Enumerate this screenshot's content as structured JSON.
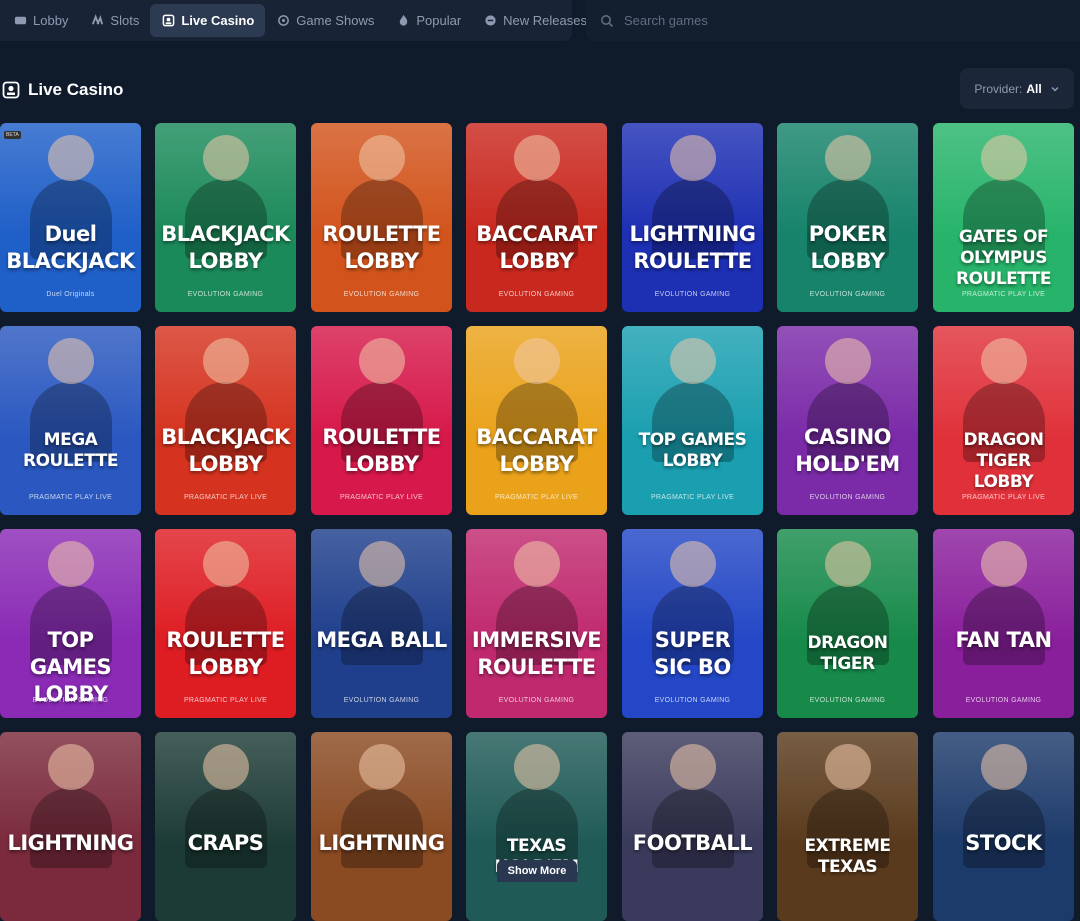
{
  "nav": {
    "tabs": [
      {
        "label": "Lobby",
        "icon": "lobby-icon"
      },
      {
        "label": "Slots",
        "icon": "slots-icon"
      },
      {
        "label": "Live Casino",
        "icon": "live-icon",
        "active": true
      },
      {
        "label": "Game Shows",
        "icon": "game-shows-icon"
      },
      {
        "label": "Popular",
        "icon": "fire-icon"
      },
      {
        "label": "New Releases",
        "icon": "new-releases-icon"
      }
    ],
    "search_placeholder": "Search games"
  },
  "section": {
    "title": "Live Casino"
  },
  "provider_filter": {
    "label": "Provider:",
    "value": "All"
  },
  "games": [
    {
      "title": "Duel\nBLACKJACK",
      "provider": "Duel Originals",
      "badge": "BETA",
      "color": "#1f5fc8"
    },
    {
      "title": "BLACKJACK\nLOBBY",
      "provider": "EVOLUTION GAMING",
      "color": "#1b8a5a"
    },
    {
      "title": "ROULETTE\nLOBBY",
      "provider": "EVOLUTION GAMING",
      "color": "#d2541c"
    },
    {
      "title": "BACCARAT\nLOBBY",
      "provider": "EVOLUTION GAMING",
      "color": "#c9281e"
    },
    {
      "title": "LIGHTNING\nROULETTE",
      "provider": "EVOLUTION GAMING",
      "color": "#1d2fb3"
    },
    {
      "title": "POKER\nLOBBY",
      "provider": "EVOLUTION GAMING",
      "color": "#16836a"
    },
    {
      "title": "GATES OF\nOLYMPUS\nROULETTE",
      "provider": "PRAGMATIC PLAY LIVE",
      "color": "#27b46a",
      "small": true
    },
    {
      "title": "MEGA\nROULETTE",
      "provider": "PRAGMATIC PLAY LIVE",
      "color": "#2a58c0",
      "small": true
    },
    {
      "title": "BLACKJACK\nLOBBY",
      "provider": "PRAGMATIC PLAY LIVE",
      "color": "#d5331f"
    },
    {
      "title": "ROULETTE\nLOBBY",
      "provider": "PRAGMATIC PLAY LIVE",
      "color": "#d6184a"
    },
    {
      "title": "BACCARAT\nLOBBY",
      "provider": "PRAGMATIC PLAY LIVE",
      "color": "#eaa21a"
    },
    {
      "title": "TOP GAMES\nLOBBY",
      "provider": "PRAGMATIC PLAY LIVE",
      "color": "#1a9fb0",
      "small": true
    },
    {
      "title": "CASINO\nHOLD'EM",
      "provider": "EVOLUTION GAMING",
      "color": "#7b2aa8"
    },
    {
      "title": "DRAGON TIGER\nLOBBY",
      "provider": "PRAGMATIC PLAY LIVE",
      "color": "#e0313a",
      "small": true
    },
    {
      "title": "TOP GAMES\nLOBBY",
      "provider": "EVOLUTION GAMING",
      "color": "#8a2ab5"
    },
    {
      "title": "ROULETTE\nLOBBY",
      "provider": "PRAGMATIC PLAY LIVE",
      "color": "#de1d23"
    },
    {
      "title": "MEGA BALL",
      "provider": "EVOLUTION GAMING",
      "color": "#1f3f8c"
    },
    {
      "title": "IMMERSIVE\nROULETTE",
      "provider": "EVOLUTION GAMING",
      "color": "#c0296e"
    },
    {
      "title": "SUPER\nSIC BO",
      "provider": "EVOLUTION GAMING",
      "color": "#2347c6"
    },
    {
      "title": "DRAGON\nTIGER",
      "provider": "EVOLUTION GAMING",
      "color": "#178a4a",
      "small": true
    },
    {
      "title": "FAN TAN",
      "provider": "EVOLUTION GAMING",
      "color": "#8a1f9c"
    },
    {
      "title": "LIGHTNING",
      "provider": "",
      "color": "#7a2a3c"
    },
    {
      "title": "CRAPS",
      "provider": "",
      "color": "#1d3b36"
    },
    {
      "title": "LIGHTNING",
      "provider": "",
      "color": "#8a4a22"
    },
    {
      "title": "TEXAS HOLD'EM",
      "provider": "",
      "color": "#1f5a56",
      "small": true
    },
    {
      "title": "FOOTBALL",
      "provider": "",
      "color": "#3a3a5c"
    },
    {
      "title": "EXTREME TEXAS",
      "provider": "",
      "color": "#5a3a1c",
      "small": true
    },
    {
      "title": "STOCK",
      "provider": "",
      "color": "#1c3a6a"
    }
  ],
  "show_more": "Show More"
}
